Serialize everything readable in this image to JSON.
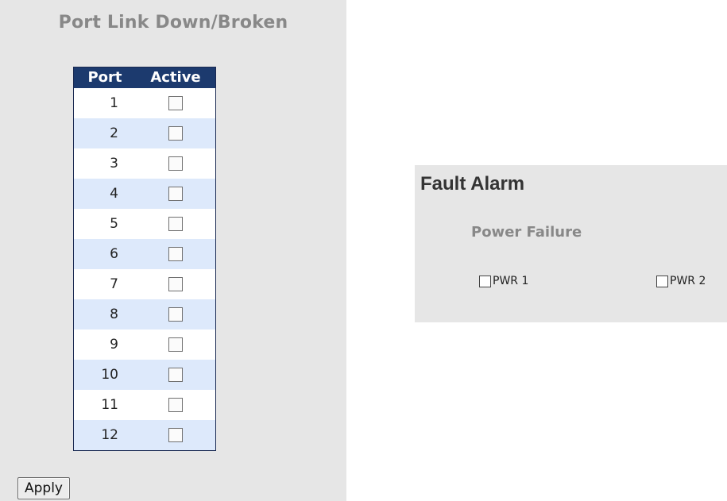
{
  "port_section": {
    "title": "Port Link Down/Broken",
    "columns": [
      "Port",
      "Active"
    ],
    "ports": [
      {
        "port": "1",
        "active": false
      },
      {
        "port": "2",
        "active": false
      },
      {
        "port": "3",
        "active": false
      },
      {
        "port": "4",
        "active": false
      },
      {
        "port": "5",
        "active": false
      },
      {
        "port": "6",
        "active": false
      },
      {
        "port": "7",
        "active": false
      },
      {
        "port": "8",
        "active": false
      },
      {
        "port": "9",
        "active": false
      },
      {
        "port": "10",
        "active": false
      },
      {
        "port": "11",
        "active": false
      },
      {
        "port": "12",
        "active": false
      }
    ],
    "apply_label": "Apply"
  },
  "fault_alarm": {
    "title": "Fault Alarm",
    "power_failure_title": "Power Failure",
    "pwr1_label": "PWR 1",
    "pwr2_label": "PWR 2",
    "pwr1_checked": false,
    "pwr2_checked": false
  },
  "colors": {
    "panel_bg": "#e6e6e6",
    "header_bg": "#1c3a6e",
    "alt_row": "#dde9fb",
    "muted_title": "#888888"
  }
}
